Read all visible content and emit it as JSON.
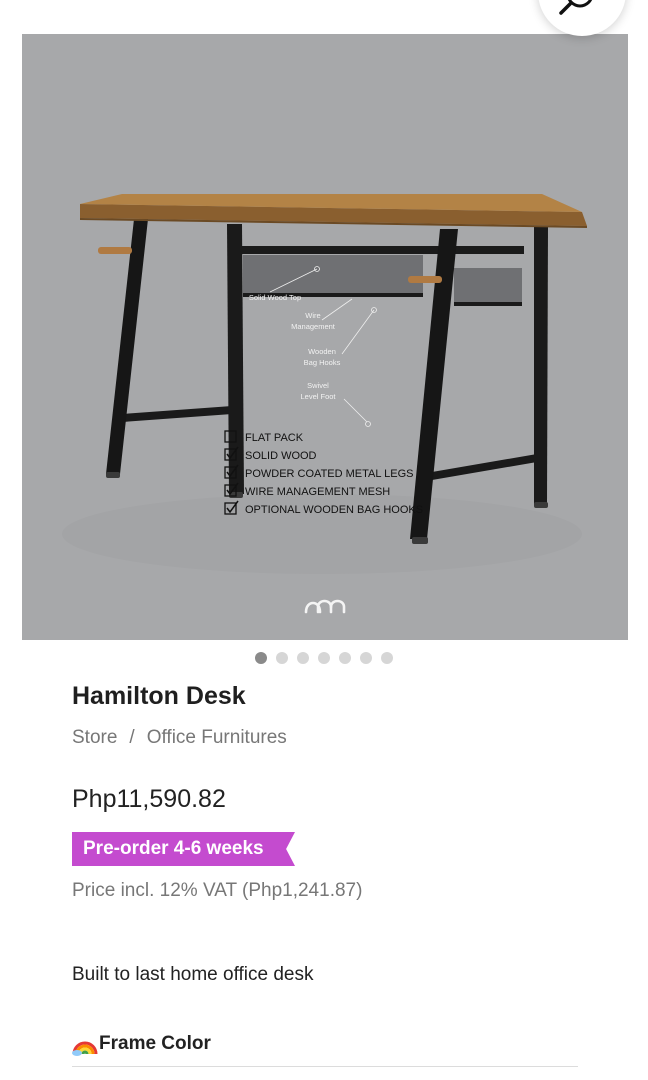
{
  "product": {
    "title": "Hamilton Desk",
    "breadcrumb": {
      "store": "Store",
      "separator": "/",
      "category": "Office Furnitures"
    },
    "price": "Php11,590.82",
    "badge": "Pre-order 4-6 weeks",
    "vat_note": "Price incl. 12% VAT (Php1,241.87)",
    "description": "Built to last home office desk",
    "option_label": "Frame Color"
  },
  "image": {
    "feature_labels": {
      "solid_wood_top": "Solid Wood Top",
      "wire_1": "Wire",
      "wire_2": "Management",
      "hooks_1": "Wooden",
      "hooks_2": "Bag Hooks",
      "swivel_1": "Swivel",
      "swivel_2": "Level Foot"
    },
    "checklist": [
      "FLAT PACK",
      "SOLID WOOD",
      "POWDER COATED METAL LEGS",
      "WIRE MANAGEMENT MESH",
      "OPTIONAL WOODEN BAG HOOKS"
    ],
    "logo": "nm"
  },
  "carousel": {
    "count": 7,
    "active_index": 0
  },
  "icons": {
    "zoom": "magnifier-icon",
    "option": "rainbow-icon"
  },
  "colors": {
    "badge": "#c44bcf",
    "image_bg": "#a7a8aa",
    "wood": "#a8783f",
    "frame": "#161616"
  }
}
